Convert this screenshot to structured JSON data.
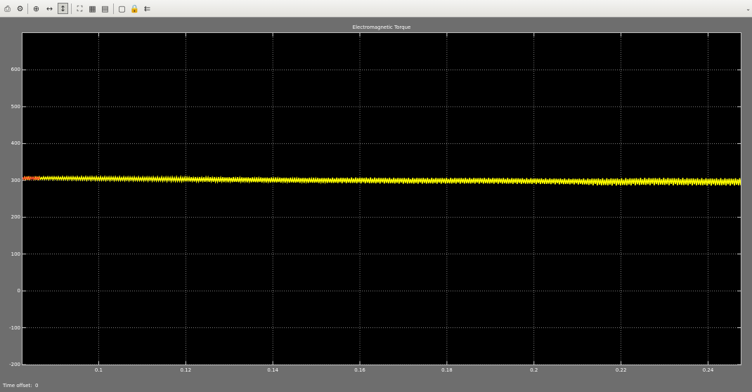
{
  "toolbar": {
    "buttons": [
      {
        "name": "print-icon",
        "glyph": "⎙"
      },
      {
        "name": "parameters-icon",
        "glyph": "⚙"
      },
      {
        "name": "zoom-icon",
        "glyph": "⊕"
      },
      {
        "name": "zoom-x-icon",
        "glyph": "↔"
      },
      {
        "name": "zoom-y-icon",
        "glyph": "↕"
      },
      {
        "name": "autoscale-icon",
        "glyph": "⛶"
      },
      {
        "name": "save-axes-icon",
        "glyph": "▦"
      },
      {
        "name": "restore-axes-icon",
        "glyph": "▤"
      },
      {
        "name": "float-scope-icon",
        "glyph": "▢"
      },
      {
        "name": "lock-axes-icon",
        "glyph": "🔒"
      },
      {
        "name": "signal-selection-icon",
        "glyph": "⇇"
      }
    ],
    "corner_glyph": "⌄"
  },
  "chart_data": {
    "type": "line",
    "title": "Electromagnetic Torque",
    "xlabel": "",
    "ylabel": "",
    "xlim": [
      0.0825,
      0.2475
    ],
    "ylim": [
      -200,
      700
    ],
    "xticks": [
      0.1,
      0.12,
      0.14,
      0.16,
      0.18,
      0.2,
      0.22,
      0.24
    ],
    "xtick_labels": [
      "0.1",
      "0.12",
      "0.14",
      "0.16",
      "0.18",
      "0.2",
      "0.22",
      "0.24"
    ],
    "yticks": [
      -200,
      -100,
      0,
      100,
      200,
      300,
      400,
      500,
      600
    ],
    "ytick_labels": [
      "-200",
      "-100",
      "0",
      "100",
      "200",
      "300",
      "400",
      "500",
      "600"
    ],
    "grid": true,
    "background": "#000000",
    "grid_color": "#d0d0d0",
    "series": [
      {
        "color": "#ffff00",
        "x": [
          0.0825,
          0.09,
          0.1,
          0.11,
          0.12,
          0.13,
          0.14,
          0.15,
          0.16,
          0.17,
          0.18,
          0.19,
          0.2,
          0.21,
          0.215,
          0.22,
          0.225,
          0.23,
          0.24,
          0.2475
        ],
        "mean": [
          306,
          306,
          305,
          304,
          303,
          302,
          301,
          300,
          300,
          299,
          299,
          299,
          298,
          297,
          296,
          296,
          297,
          297,
          296,
          296
        ],
        "ripple": [
          3,
          4,
          5,
          5,
          6,
          7,
          7,
          7,
          8,
          8,
          8,
          8,
          8,
          8,
          10,
          10,
          10,
          10,
          10,
          10
        ]
      },
      {
        "color": "#ff3030",
        "x": [
          0.0825,
          0.0865
        ],
        "mean": [
          306,
          306
        ],
        "ripple": [
          4,
          4
        ]
      }
    ]
  },
  "time_offset": {
    "label": "Time offset:",
    "value": "0"
  }
}
